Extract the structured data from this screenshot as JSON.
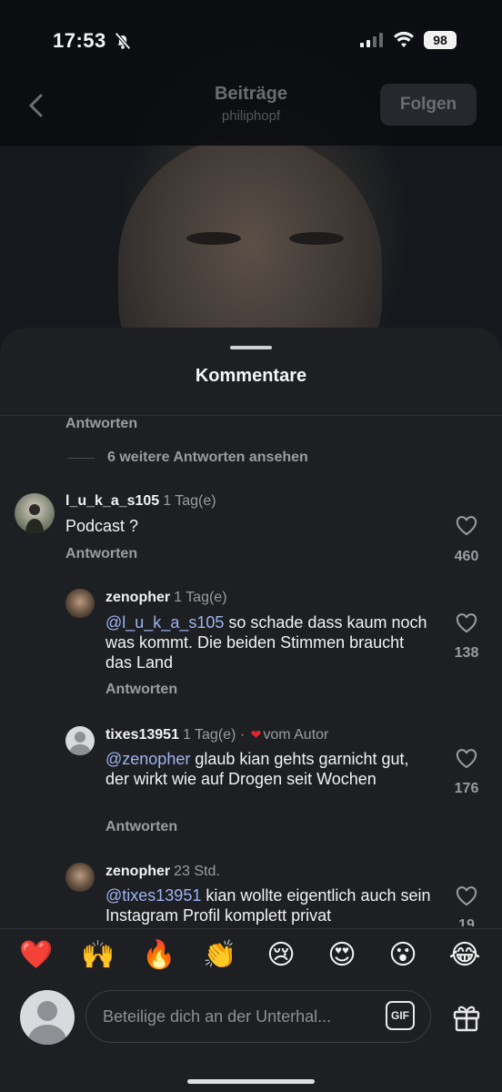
{
  "status_bar": {
    "time": "17:53",
    "battery": "98"
  },
  "nav": {
    "title": "Beiträge",
    "subtitle": "philiphopf",
    "follow_label": "Folgen"
  },
  "sheet": {
    "title": "Kommentare"
  },
  "thread": {
    "reply_label_top": "Antworten",
    "more_replies": "6 weitere Antworten ansehen"
  },
  "comments": [
    {
      "username": "l_u_k_a_s105",
      "age": "1 Tag(e)",
      "mention": "",
      "text": "Podcast ?",
      "likes": "460",
      "reply": "Antworten"
    },
    {
      "username": "zenopher",
      "age": "1 Tag(e)",
      "mention": "@l_u_k_a_s105",
      "text": " so schade dass kaum noch was kommt. Die beiden Stimmen braucht das Land",
      "likes": "138",
      "reply": "Antworten"
    },
    {
      "username": "tixes13951",
      "age": "1 Tag(e)",
      "by_author": "vom Autor",
      "mention": "@zenopher",
      "text": " glaub kian gehts garnicht gut, der wirkt wie auf Drogen seit Wochen",
      "likes": "176",
      "reply": "Antworten"
    },
    {
      "username": "zenopher",
      "age": "23 Std.",
      "mention": "@tixes13951",
      "text": " kian wollte eigentlich auch sein Instagram Profil komplett privat",
      "likes": "19"
    }
  ],
  "emoji_bar": [
    "❤️",
    "🙌",
    "🔥",
    "👏",
    "😢",
    "😍",
    "😮",
    "😂"
  ],
  "composer": {
    "placeholder": "Beteilige dich an der Unterhal...",
    "gif_label": "GIF"
  },
  "icons": {
    "back": "chevron-left-icon",
    "mute": "bell-off-icon",
    "like": "heart-outline-icon",
    "gif": "gif-icon",
    "gift": "gift-icon"
  },
  "colors": {
    "mention": "#9db4f0",
    "author_heart": "#e0282e",
    "sheet_bg": "#1e1f23"
  }
}
